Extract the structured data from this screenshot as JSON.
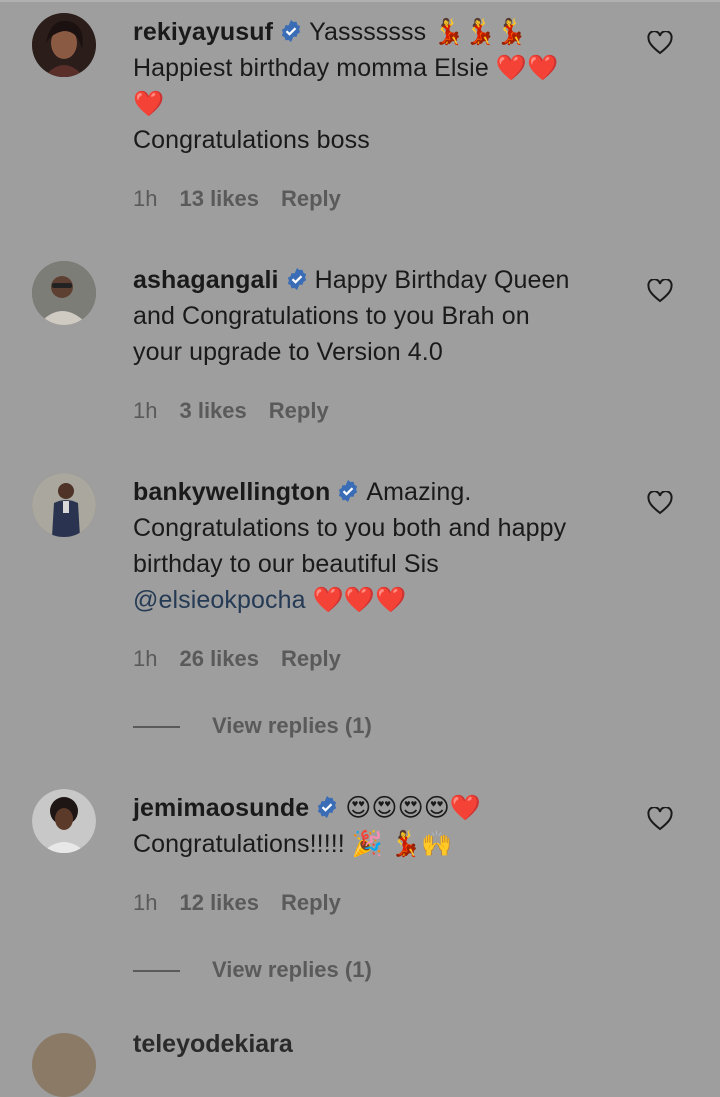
{
  "comments": [
    {
      "username": "rekiyayusuf",
      "text_lines": [
        "Yasssssss 💃💃💃",
        "Happiest birthday momma Elsie ❤️❤️",
        "❤️",
        "Congratulations boss"
      ],
      "time": "1h",
      "likes": "13 likes",
      "reply": "Reply"
    },
    {
      "username": "ashagangali",
      "text_lines": [
        "Happy Birthday Queen",
        "and Congratulations to you Brah on",
        "your upgrade to Version 4.0"
      ],
      "time": "1h",
      "likes": "3 likes",
      "reply": "Reply"
    },
    {
      "username": "bankywellington",
      "text_lines": [
        "Amazing.",
        "Congratulations to you both and happy",
        "birthday to our beautiful Sis"
      ],
      "mention": "@elsieokpocha",
      "mention_suffix": "❤️❤️❤️",
      "time": "1h",
      "likes": "26 likes",
      "reply": "Reply",
      "view_replies": "View replies (1)"
    },
    {
      "username": "jemimaosunde",
      "text_lines": [
        "😍😍😍😍❤️",
        "Congratulations!!!!! 🎉 💃🙌"
      ],
      "time": "1h",
      "likes": "12 likes",
      "reply": "Reply",
      "view_replies": "View replies (1)"
    }
  ],
  "partial_comment_fragment": "teleyodekiara",
  "colors": {
    "background": "#9e9e9e",
    "text": "#1a1a1a",
    "meta": "#5a5a5a",
    "mention": "#253a55",
    "verified": "#3a6db5"
  },
  "icons": {
    "verified": "verified-badge-icon",
    "like": "heart-outline-icon"
  }
}
